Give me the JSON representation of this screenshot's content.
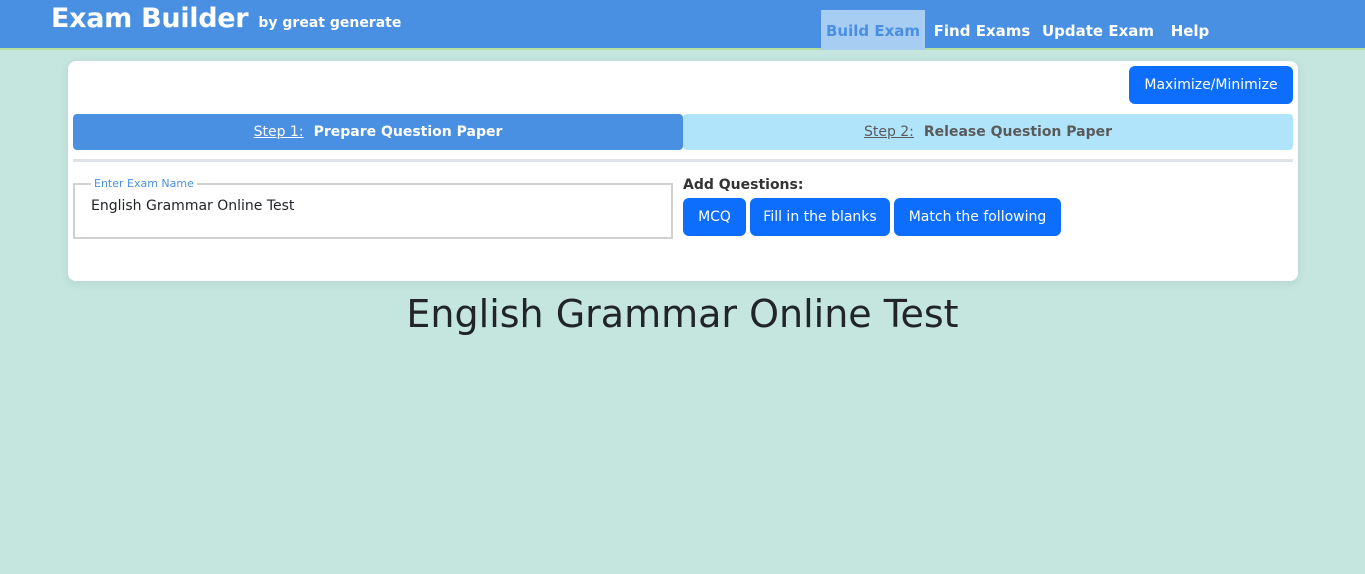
{
  "header": {
    "brand_title": "Exam Builder",
    "brand_subtitle": "by great generate",
    "nav": [
      {
        "label": "Build Exam",
        "active": true
      },
      {
        "label": "Find Exams",
        "active": false
      },
      {
        "label": "Update Exam",
        "active": false
      },
      {
        "label": "Help",
        "active": false
      }
    ]
  },
  "card": {
    "maximize_label": "Maximize/Minimize",
    "steps": [
      {
        "num": "Step 1:",
        "label": "Prepare Question Paper",
        "active": true
      },
      {
        "num": "Step 2:",
        "label": "Release Question Paper",
        "active": false
      }
    ],
    "exam_name": {
      "legend": "Enter Exam Name",
      "value": "English Grammar Online Test"
    },
    "add_questions": {
      "label": "Add Questions:",
      "buttons": [
        "MCQ",
        "Fill in the blanks",
        "Match the following"
      ]
    }
  },
  "exam_title": "English Grammar Online Test",
  "colors": {
    "navbar": "#4a90e2",
    "page_background": "#c4e6df",
    "primary_button": "#0d6efd",
    "step_active": "#4a90e2",
    "step_inactive": "#b0e4fb"
  }
}
